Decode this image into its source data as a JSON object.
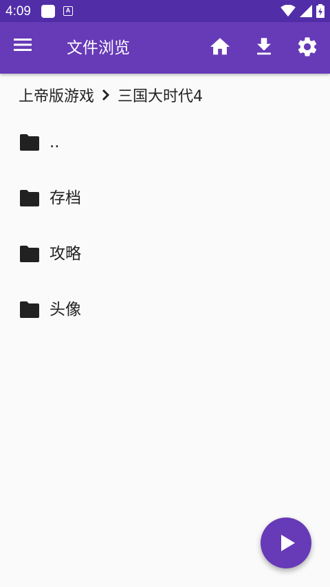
{
  "status_bar": {
    "time": "4:09",
    "icons": [
      "notification-square-icon",
      "a-badge-icon",
      "wifi-icon",
      "signal-icon",
      "battery-icon"
    ]
  },
  "app_bar": {
    "title": "文件浏览",
    "actions": [
      "home-icon",
      "download-icon",
      "settings-icon"
    ],
    "color": "#673ab7",
    "status_color": "#512da8"
  },
  "breadcrumb": {
    "parent": "上帝版游戏",
    "current": "三国大时代4"
  },
  "files": [
    {
      "name": "..",
      "icon": "folder-icon"
    },
    {
      "name": "存档",
      "icon": "folder-icon"
    },
    {
      "name": "攻略",
      "icon": "folder-icon"
    },
    {
      "name": "头像",
      "icon": "folder-icon"
    }
  ],
  "fab": {
    "icon": "play-icon",
    "color": "#673ab7"
  }
}
